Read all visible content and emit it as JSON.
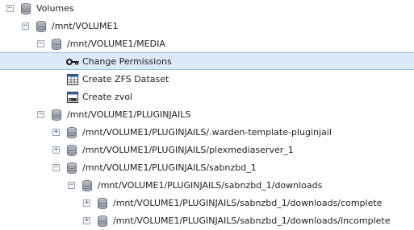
{
  "tree": {
    "rows": [
      {
        "label": "Volumes",
        "toggle": "−",
        "icon": "database-icon"
      },
      {
        "label": "/mnt/VOLUME1",
        "toggle": "−",
        "icon": "database-icon"
      },
      {
        "label": "/mnt/VOLUME1/MEDIA",
        "toggle": "−",
        "icon": "database-icon"
      },
      {
        "label": "Change Permissions",
        "icon": "key-icon",
        "selected": true
      },
      {
        "label": "Create ZFS Dataset",
        "icon": "dataset-icon"
      },
      {
        "label": "Create zvol",
        "icon": "zvol-icon"
      },
      {
        "label": "/mnt/VOLUME1/PLUGINJAILS",
        "toggle": "−",
        "icon": "database-icon"
      },
      {
        "label": "/mnt/VOLUME1/PLUGINJAILS/.warden-template-pluginjail",
        "toggle": "+",
        "icon": "database-icon"
      },
      {
        "label": "/mnt/VOLUME1/PLUGINJAILS/plexmediaserver_1",
        "toggle": "+",
        "icon": "database-icon"
      },
      {
        "label": "/mnt/VOLUME1/PLUGINJAILS/sabnzbd_1",
        "toggle": "−",
        "icon": "database-icon"
      },
      {
        "label": "/mnt/VOLUME1/PLUGINJAILS/sabnzbd_1/downloads",
        "toggle": "−",
        "icon": "database-icon"
      },
      {
        "label": "/mnt/VOLUME1/PLUGINJAILS/sabnzbd_1/downloads/complete",
        "toggle": "+",
        "icon": "database-icon"
      },
      {
        "label": "/mnt/VOLUME1/PLUGINJAILS/sabnzbd_1/downloads/incomplete",
        "toggle": "+",
        "icon": "database-icon"
      }
    ]
  },
  "colors": {
    "selection_background": "#dce9f8",
    "selection_border": "#9fbfe3",
    "text": "#222222"
  }
}
